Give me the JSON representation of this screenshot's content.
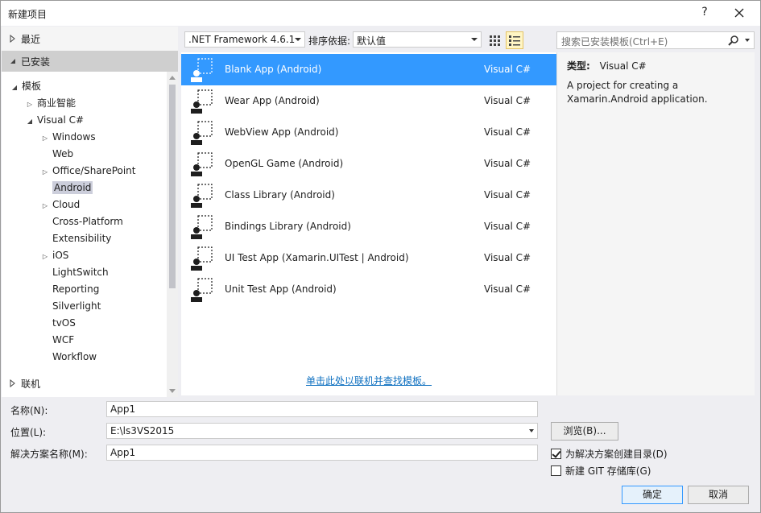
{
  "window": {
    "title": "新建项目",
    "help_glyph": "?"
  },
  "left_pane": {
    "recent_label": "最近",
    "installed_label": "已安装",
    "online_label": "联机",
    "tree": [
      {
        "label": "模板",
        "expander": "◢",
        "indent": 0,
        "selected": false
      },
      {
        "label": "商业智能",
        "expander": "▷",
        "indent": 1,
        "selected": false
      },
      {
        "label": "Visual C#",
        "expander": "◢",
        "indent": 1,
        "selected": false
      },
      {
        "label": "Windows",
        "expander": "▷",
        "indent": 2,
        "selected": false
      },
      {
        "label": "Web",
        "expander": "",
        "indent": 2,
        "selected": false
      },
      {
        "label": "Office/SharePoint",
        "expander": "▷",
        "indent": 2,
        "selected": false
      },
      {
        "label": "Android",
        "expander": "",
        "indent": 2,
        "selected": true
      },
      {
        "label": "Cloud",
        "expander": "▷",
        "indent": 2,
        "selected": false
      },
      {
        "label": "Cross-Platform",
        "expander": "",
        "indent": 2,
        "selected": false
      },
      {
        "label": "Extensibility",
        "expander": "",
        "indent": 2,
        "selected": false
      },
      {
        "label": "iOS",
        "expander": "▷",
        "indent": 2,
        "selected": false
      },
      {
        "label": "LightSwitch",
        "expander": "",
        "indent": 2,
        "selected": false
      },
      {
        "label": "Reporting",
        "expander": "",
        "indent": 2,
        "selected": false
      },
      {
        "label": "Silverlight",
        "expander": "",
        "indent": 2,
        "selected": false
      },
      {
        "label": "tvOS",
        "expander": "",
        "indent": 2,
        "selected": false
      },
      {
        "label": "WCF",
        "expander": "",
        "indent": 2,
        "selected": false
      },
      {
        "label": "Workflow",
        "expander": "",
        "indent": 2,
        "selected": false
      }
    ]
  },
  "toolbar": {
    "framework": ".NET Framework 4.6.1",
    "sort_label": "排序依据:",
    "sort_value": "默认值",
    "search_placeholder": "搜索已安装模板(Ctrl+E)"
  },
  "templates": [
    {
      "name": "Blank App (Android)",
      "lang": "Visual C#",
      "selected": true
    },
    {
      "name": "Wear App (Android)",
      "lang": "Visual C#",
      "selected": false
    },
    {
      "name": "WebView App (Android)",
      "lang": "Visual C#",
      "selected": false
    },
    {
      "name": "OpenGL Game (Android)",
      "lang": "Visual C#",
      "selected": false
    },
    {
      "name": "Class Library (Android)",
      "lang": "Visual C#",
      "selected": false
    },
    {
      "name": "Bindings Library (Android)",
      "lang": "Visual C#",
      "selected": false
    },
    {
      "name": "UI Test App (Xamarin.UITest | Android)",
      "lang": "Visual C#",
      "selected": false
    },
    {
      "name": "Unit Test App (Android)",
      "lang": "Visual C#",
      "selected": false
    }
  ],
  "online_link": "单击此处以联机并查找模板。",
  "details": {
    "type_label": "类型:",
    "type_value": "Visual C#",
    "description": "A project for creating a Xamarin.Android application."
  },
  "form": {
    "name_label": "名称(N):",
    "name_value": "App1",
    "location_label": "位置(L):",
    "location_value": "E:\\ls3VS2015",
    "solution_label": "解决方案名称(M):",
    "solution_value": "App1",
    "browse_label": "浏览(B)...",
    "create_dir_label": "为解决方案创建目录(D)",
    "create_dir_checked": true,
    "git_label": "新建 GIT 存储库(G)",
    "git_checked": false,
    "ok_label": "确定",
    "cancel_label": "取消"
  },
  "colors": {
    "selection": "#3399ff",
    "link": "#0e70c0",
    "tree_selected": "#cccedb"
  }
}
